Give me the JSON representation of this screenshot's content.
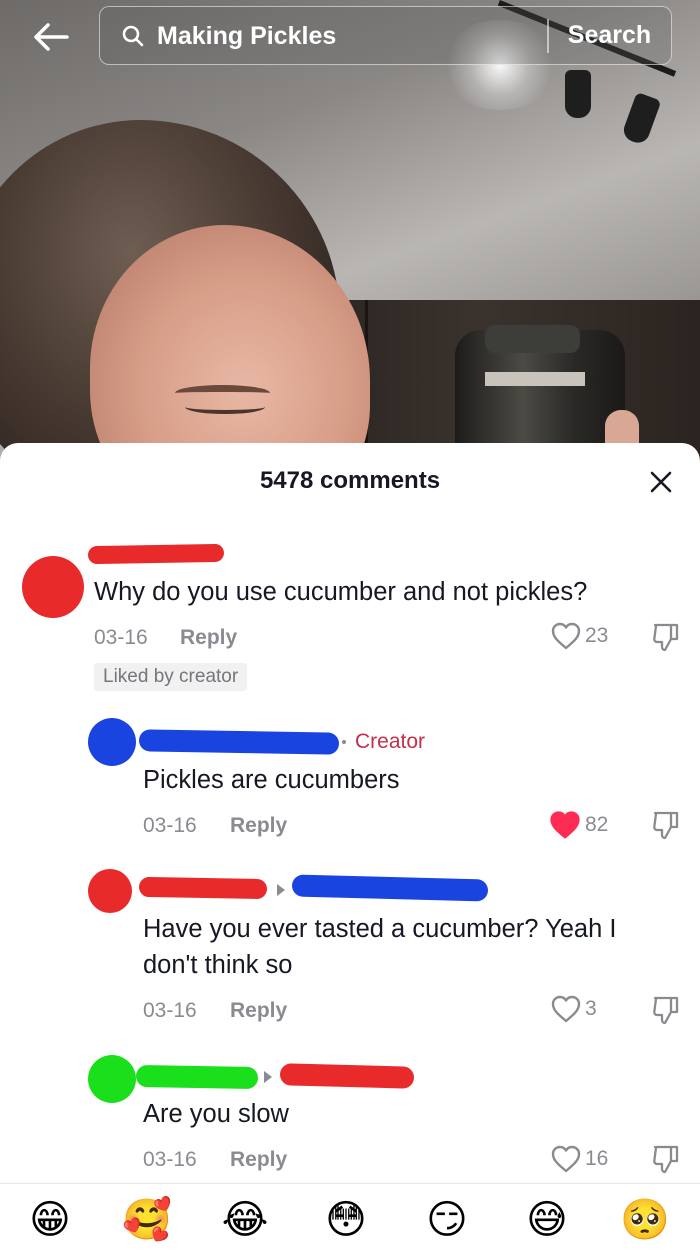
{
  "search": {
    "query": "Making Pickles",
    "button_label": "Search"
  },
  "comments_panel": {
    "title": "5478 comments"
  },
  "comments": [
    {
      "text": "Why do you use cucumber and not pickles?",
      "date": "03-16",
      "reply_label": "Reply",
      "likes": "23",
      "liked": false,
      "badge": "Liked by creator",
      "avatar_color": "#e82a2a",
      "name_redaction_color": "#e82a2a"
    },
    {
      "text": "Pickles are cucumbers",
      "date": "03-16",
      "reply_label": "Reply",
      "likes": "82",
      "liked": true,
      "creator_label": "Creator",
      "avatar_color": "#1a44e0",
      "name_redaction_color": "#1a44e0"
    },
    {
      "text_line1": "Have you ever tasted a cucumber? Yeah I",
      "text_line2": "don't think so",
      "date": "03-16",
      "reply_label": "Reply",
      "likes": "3",
      "liked": false,
      "avatar_color": "#e82a2a",
      "name_redaction_color": "#e82a2a",
      "reply_to_redaction_color": "#1a44e0"
    },
    {
      "text": "Are you slow",
      "date": "03-16",
      "reply_label": "Reply",
      "likes": "16",
      "liked": false,
      "avatar_color": "#19e01a",
      "name_redaction_color": "#19e01a",
      "reply_to_redaction_color": "#e82a2a"
    }
  ],
  "emoji_bar": [
    "😁",
    "🥰",
    "😂",
    "😳",
    "😏",
    "😅",
    "🥺"
  ],
  "colors": {
    "like_red": "#fe2c55",
    "text_primary": "#161823",
    "text_secondary": "#8a8b91",
    "creator_tag": "#c72e4c"
  }
}
